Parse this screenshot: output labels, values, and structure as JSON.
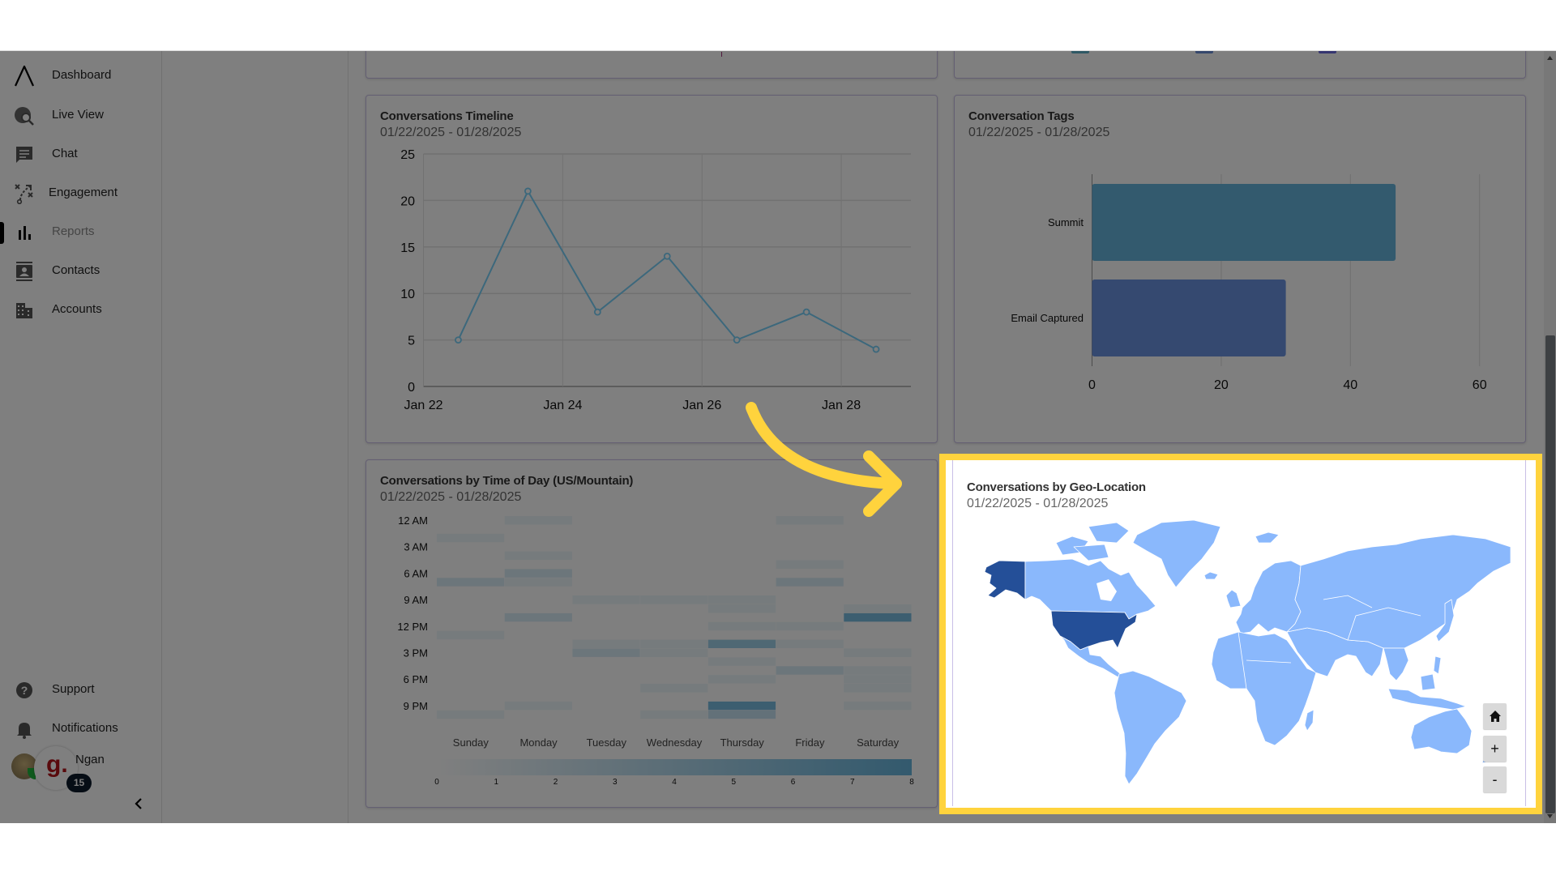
{
  "sidebar": {
    "items": [
      {
        "label": "Dashboard",
        "icon": "logo-icon"
      },
      {
        "label": "Live View",
        "icon": "globe-search-icon"
      },
      {
        "label": "Chat",
        "icon": "chat-icon"
      },
      {
        "label": "Engagement",
        "icon": "engagement-icon"
      },
      {
        "label": "Reports",
        "icon": "bar-chart-icon",
        "active": true
      },
      {
        "label": "Contacts",
        "icon": "contacts-icon"
      },
      {
        "label": "Accounts",
        "icon": "building-icon"
      }
    ],
    "bottom": [
      {
        "label": "Support",
        "icon": "help-icon"
      },
      {
        "label": "Notifications",
        "icon": "bell-icon"
      }
    ],
    "user": {
      "name": "Ngan",
      "badge": "15",
      "org_logo": "g."
    },
    "collapse_icon": "chevron-left-icon"
  },
  "top_legend_colors": [
    "#5fb0c8",
    "#6a8fd8",
    "#6a6ae0"
  ],
  "cards": {
    "timeline": {
      "title": "Conversations Timeline",
      "date_range": "01/22/2025 - 01/28/2025"
    },
    "tags": {
      "title": "Conversation Tags",
      "date_range": "01/22/2025 - 01/28/2025"
    },
    "time_of_day": {
      "title": "Conversations by Time of Day (US/Mountain)",
      "date_range": "01/22/2025 - 01/28/2025"
    },
    "geo": {
      "title": "Conversations by Geo-Location",
      "date_range": "01/22/2025 - 01/28/2025"
    }
  },
  "map_controls": {
    "home_icon": "home-icon",
    "zoom_in": "+",
    "zoom_out": "-"
  },
  "annotation": {
    "arrow_color": "#ffd33d",
    "highlight_color": "#ffd33d"
  },
  "chart_data": [
    {
      "id": "timeline",
      "type": "line",
      "x": [
        "2025-01-22",
        "2025-01-23",
        "2025-01-24",
        "2025-01-25",
        "2025-01-26",
        "2025-01-27",
        "2025-01-28"
      ],
      "values": [
        5,
        21,
        8,
        14,
        5,
        8,
        4
      ],
      "x_ticks": [
        "Jan 22",
        "Jan 24",
        "Jan 26",
        "Jan 28"
      ],
      "y_ticks": [
        0,
        5,
        10,
        15,
        20,
        25
      ],
      "ylim": [
        0,
        25
      ],
      "grid": true,
      "color": "#78d0f8"
    },
    {
      "id": "tags",
      "type": "bar",
      "orientation": "horizontal",
      "categories": [
        "Summit",
        "Email Captured"
      ],
      "values": [
        47,
        30
      ],
      "colors": [
        "#66b4dc",
        "#6a92e0"
      ],
      "x_ticks": [
        0,
        20,
        40,
        60
      ],
      "xlim": [
        0,
        65
      ],
      "grid": true
    },
    {
      "id": "time_of_day",
      "type": "heatmap",
      "days": [
        "Sunday",
        "Monday",
        "Tuesday",
        "Wednesday",
        "Thursday",
        "Friday",
        "Saturday"
      ],
      "y_ticks": [
        "12 AM",
        "3 AM",
        "6 AM",
        "9 AM",
        "12 PM",
        "3 PM",
        "6 PM",
        "9 PM"
      ],
      "colorbar_ticks": [
        0,
        1,
        2,
        3,
        4,
        5,
        6,
        7,
        8
      ],
      "range": [
        0,
        8
      ],
      "color_min": "#ffffff",
      "color_max": "#66b4dc",
      "cells": [
        {
          "day": "Sunday",
          "hour": 2,
          "value": 1
        },
        {
          "day": "Sunday",
          "hour": 7,
          "value": 2
        },
        {
          "day": "Sunday",
          "hour": 13,
          "value": 1
        },
        {
          "day": "Sunday",
          "hour": 22,
          "value": 1
        },
        {
          "day": "Monday",
          "hour": 0,
          "value": 1
        },
        {
          "day": "Monday",
          "hour": 4,
          "value": 1
        },
        {
          "day": "Monday",
          "hour": 6,
          "value": 2
        },
        {
          "day": "Monday",
          "hour": 7,
          "value": 1
        },
        {
          "day": "Monday",
          "hour": 11,
          "value": 2
        },
        {
          "day": "Monday",
          "hour": 21,
          "value": 1
        },
        {
          "day": "Tuesday",
          "hour": 9,
          "value": 1
        },
        {
          "day": "Tuesday",
          "hour": 14,
          "value": 1
        },
        {
          "day": "Tuesday",
          "hour": 15,
          "value": 2
        },
        {
          "day": "Wednesday",
          "hour": 9,
          "value": 1
        },
        {
          "day": "Wednesday",
          "hour": 14,
          "value": 1
        },
        {
          "day": "Wednesday",
          "hour": 15,
          "value": 1
        },
        {
          "day": "Wednesday",
          "hour": 19,
          "value": 1
        },
        {
          "day": "Wednesday",
          "hour": 22,
          "value": 1
        },
        {
          "day": "Thursday",
          "hour": 9,
          "value": 1
        },
        {
          "day": "Thursday",
          "hour": 10,
          "value": 1
        },
        {
          "day": "Thursday",
          "hour": 12,
          "value": 1
        },
        {
          "day": "Thursday",
          "hour": 14,
          "value": 5
        },
        {
          "day": "Thursday",
          "hour": 16,
          "value": 1
        },
        {
          "day": "Thursday",
          "hour": 18,
          "value": 1
        },
        {
          "day": "Thursday",
          "hour": 21,
          "value": 7
        },
        {
          "day": "Thursday",
          "hour": 22,
          "value": 3
        },
        {
          "day": "Friday",
          "hour": 0,
          "value": 1
        },
        {
          "day": "Friday",
          "hour": 5,
          "value": 1
        },
        {
          "day": "Friday",
          "hour": 7,
          "value": 2
        },
        {
          "day": "Friday",
          "hour": 12,
          "value": 1
        },
        {
          "day": "Friday",
          "hour": 14,
          "value": 1
        },
        {
          "day": "Friday",
          "hour": 17,
          "value": 2
        },
        {
          "day": "Saturday",
          "hour": 10,
          "value": 1
        },
        {
          "day": "Saturday",
          "hour": 11,
          "value": 7
        },
        {
          "day": "Saturday",
          "hour": 15,
          "value": 1
        },
        {
          "day": "Saturday",
          "hour": 17,
          "value": 1
        },
        {
          "day": "Saturday",
          "hour": 18,
          "value": 1
        },
        {
          "day": "Saturday",
          "hour": 19,
          "value": 1
        },
        {
          "day": "Saturday",
          "hour": 21,
          "value": 1
        }
      ]
    },
    {
      "id": "geo",
      "type": "choropleth",
      "base_color": "#8ab8fc",
      "highlight_color": "#244f98"
    }
  ]
}
